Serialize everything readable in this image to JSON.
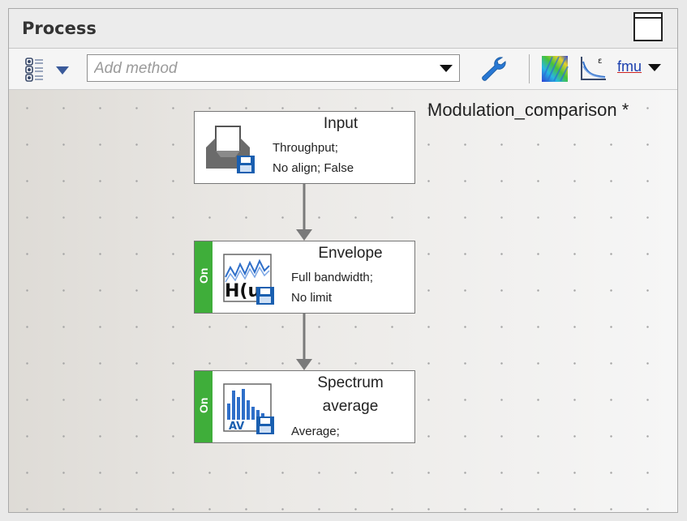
{
  "panel": {
    "title": "Process"
  },
  "toolbar": {
    "layout_icon": "list-layout-icon",
    "add_method_placeholder": "Add method",
    "wrench_icon": "wrench-icon",
    "colormap_icon": "colormap-icon",
    "curve_icon": "decay-curve-icon",
    "fmu_label": "fmu"
  },
  "canvas": {
    "title": "Modulation_comparison *",
    "nodes": [
      {
        "title": "Input",
        "lines": [
          "Throughput;",
          "No align; False"
        ],
        "icon": "inbox-tray-icon",
        "state": ""
      },
      {
        "title": "Envelope",
        "lines": [
          "Full bandwidth;",
          "No limit"
        ],
        "icon": "envelope-waveform-icon",
        "icon_text": "H(u",
        "state": "On"
      },
      {
        "title_line1": "Spectrum",
        "title_line2": "average",
        "lines": [
          "Average;"
        ],
        "icon": "spectrum-bars-icon",
        "icon_text": "AV",
        "state": "On"
      }
    ]
  },
  "colors": {
    "on_tab": "#3fae3a",
    "save_badge": "#1a5fb0",
    "wrench": "#2878d4"
  }
}
